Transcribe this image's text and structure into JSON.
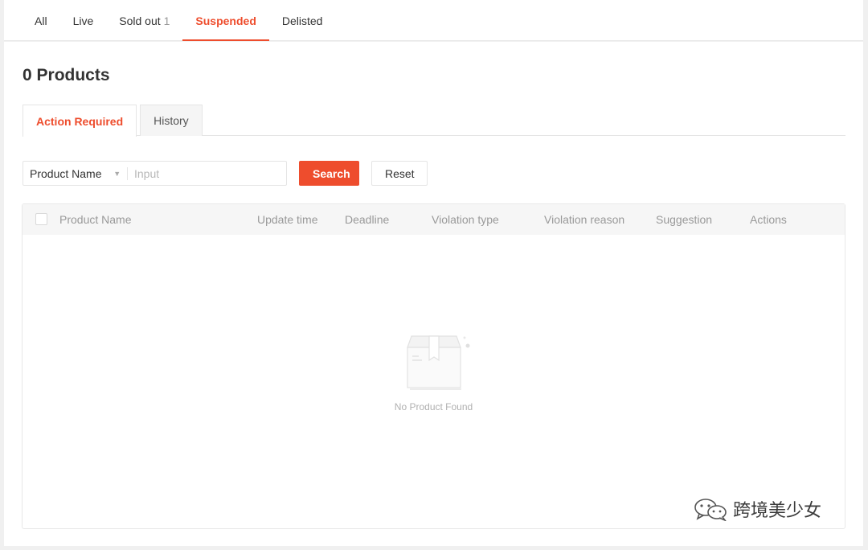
{
  "status_tabs": [
    {
      "label": "All",
      "count": ""
    },
    {
      "label": "Live",
      "count": ""
    },
    {
      "label": "Sold out",
      "count": "1"
    },
    {
      "label": "Suspended",
      "count": ""
    },
    {
      "label": "Delisted",
      "count": ""
    }
  ],
  "active_status_tab": "Suspended",
  "products_title": "0 Products",
  "sub_tabs": {
    "action_required": "Action Required",
    "history": "History"
  },
  "filter": {
    "field_selected": "Product Name",
    "input_placeholder": "Input",
    "input_value": "",
    "search_label": "Search",
    "reset_label": "Reset"
  },
  "table": {
    "columns": [
      "Product Name",
      "Update time",
      "Deadline",
      "Violation type",
      "Violation reason",
      "Suggestion",
      "Actions"
    ],
    "rows": [],
    "empty_text": "No Product Found"
  },
  "watermark_text": "跨境美少女",
  "colors": {
    "accent": "#ee4d2d",
    "muted": "#999999",
    "background": "#f0f0f0"
  },
  "icons": {
    "empty": "empty-box-icon",
    "dropdown": "caret-down-icon",
    "watermark": "wechat-icon"
  }
}
